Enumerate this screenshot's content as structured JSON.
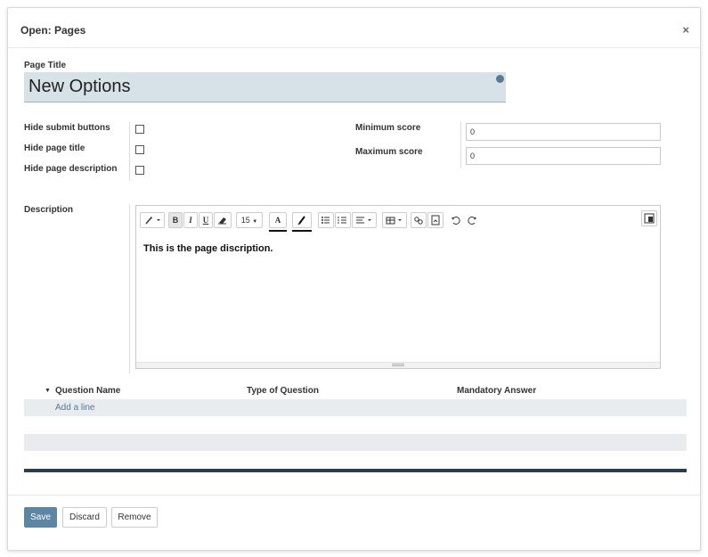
{
  "dialog": {
    "title": "Open: Pages",
    "close_label": "×"
  },
  "form": {
    "page_title_label": "Page Title",
    "page_title_value": "New Options",
    "hide_submit_label": "Hide submit buttons",
    "hide_title_label": "Hide page title",
    "hide_description_label": "Hide page description",
    "min_score_label": "Minimum score",
    "min_score_value": "0",
    "max_score_label": "Maximum score",
    "max_score_value": "0",
    "description_label": "Description"
  },
  "editor": {
    "font_size": "15",
    "bold": "B",
    "italic": "I",
    "underline": "U",
    "text_color_glyph": "A",
    "content": "This is the page discription."
  },
  "questions": {
    "col_name": "Question Name",
    "col_type": "Type of Question",
    "col_mandatory": "Mandatory Answer",
    "add_line": "Add a line"
  },
  "footer": {
    "save": "Save",
    "discard": "Discard",
    "remove": "Remove"
  }
}
